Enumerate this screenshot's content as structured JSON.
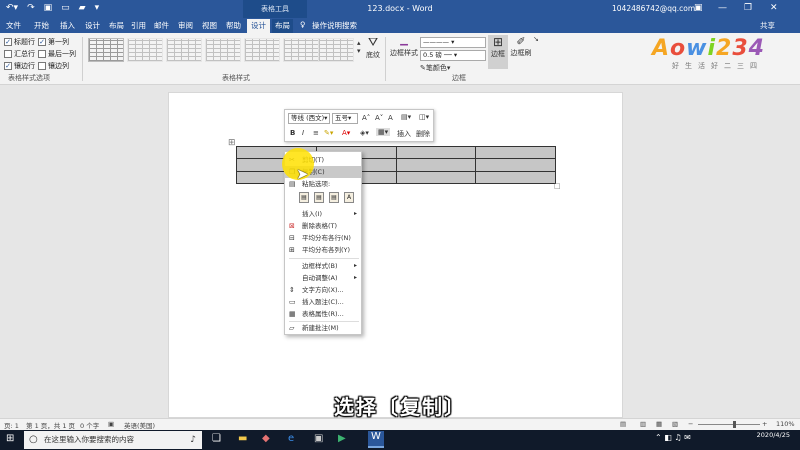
{
  "titlebar": {
    "context_tab_group": "表格工具",
    "document_title": "123.docx - Word",
    "account": "1042486742@qq.com",
    "qat_icons": [
      "undo-icon",
      "redo-icon",
      "save-icon",
      "new-document-icon",
      "open-icon",
      "customize-icon"
    ]
  },
  "tabs": [
    "文件",
    "开始",
    "插入",
    "设计",
    "布局",
    "引用",
    "邮件",
    "审阅",
    "视图",
    "帮助"
  ],
  "context_tabs": [
    "设计",
    "布局"
  ],
  "active_tab": "设计",
  "tell_me": "操作说明搜索",
  "share": "共享",
  "ribbon": {
    "style_options": [
      {
        "label": "标题行",
        "checked": true
      },
      {
        "label": "第一列",
        "checked": true
      },
      {
        "label": "汇总行",
        "checked": false
      },
      {
        "label": "最后一列",
        "checked": false
      },
      {
        "label": "镶边行",
        "checked": true
      },
      {
        "label": "镶边列",
        "checked": false
      }
    ],
    "group_style_options": "表格样式选项",
    "group_table_styles": "表格样式",
    "shading": "底纹",
    "border_styles": "边框样式",
    "line_weight": "0.5 磅",
    "pen_color": "笔颜色",
    "borders": "边框",
    "border_painter": "边框刷",
    "group_borders": "边框"
  },
  "logo": {
    "text": "Aowi234",
    "tagline": "好生活好二三四",
    "colors": [
      "#f5a623",
      "#e94e3c",
      "#4a90e2",
      "#7ed321",
      "#f5a623",
      "#e94e3c",
      "#9b59b6"
    ]
  },
  "table": {
    "rows": 3,
    "cols": 4
  },
  "mini_toolbar": {
    "font": "等线 (西文)",
    "size": "五号",
    "insert": "插入",
    "delete": "删除"
  },
  "context_menu": {
    "items": [
      {
        "label": "剪切(T)",
        "icon": "cut-icon"
      },
      {
        "label": "复制(C)",
        "icon": "copy-icon",
        "highlighted": true
      },
      {
        "label": "粘贴选项:",
        "icon": "paste-icon"
      },
      {
        "label": "插入(I)",
        "arrow": true
      },
      {
        "label": "删除表格(T)",
        "icon": "delete-table-icon"
      },
      {
        "label": "平均分布各行(N)",
        "icon": "distribute-rows-icon"
      },
      {
        "label": "平均分布各列(Y)",
        "icon": "distribute-columns-icon"
      },
      {
        "label": "边框样式(B)",
        "arrow": true
      },
      {
        "label": "自动调整(A)",
        "arrow": true
      },
      {
        "label": "文字方向(X)...",
        "icon": "text-direction-icon"
      },
      {
        "label": "插入题注(C)...",
        "icon": "insert-caption-icon"
      },
      {
        "label": "表格属性(R)...",
        "icon": "table-properties-icon"
      },
      {
        "label": "新建批注(M)",
        "icon": "new-comment-icon"
      }
    ]
  },
  "subtitle": "选择〔复制〕",
  "status": {
    "page": "页: 1",
    "pages": "第 1 页，共 1 页",
    "words": "0 个字",
    "language": "英语(美国)",
    "zoom": "110%"
  },
  "taskbar": {
    "search_placeholder": "在这里输入你要搜索的内容",
    "date": "2020/4/25"
  }
}
